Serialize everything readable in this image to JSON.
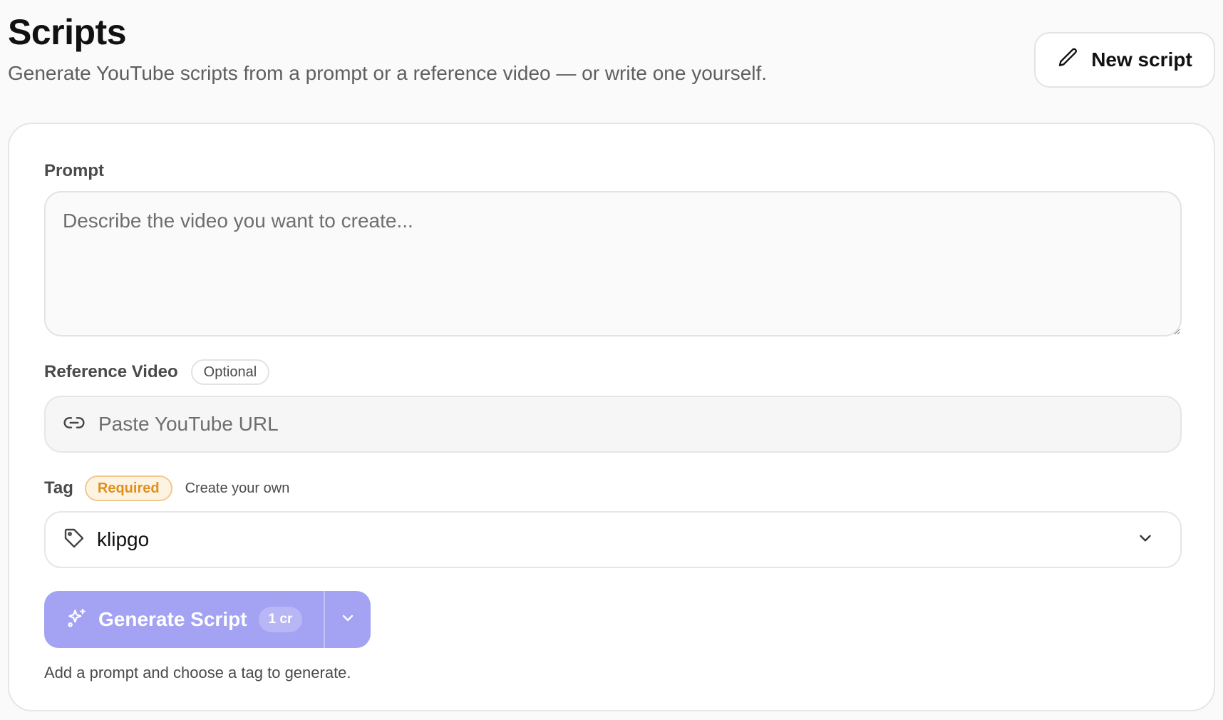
{
  "header": {
    "title": "Scripts",
    "subtitle": "Generate YouTube scripts from a prompt or a reference video — or write one yourself.",
    "new_script_label": "New script"
  },
  "prompt": {
    "label": "Prompt",
    "placeholder": "Describe the video you want to create...",
    "value": ""
  },
  "reference_video": {
    "label": "Reference Video",
    "badge": "Optional",
    "placeholder": "Paste YouTube URL",
    "value": ""
  },
  "tag": {
    "label": "Tag",
    "badge": "Required",
    "create_link": "Create your own",
    "selected": "klipgo"
  },
  "generate": {
    "label": "Generate Script",
    "cost": "1 cr",
    "hint": "Add a prompt and choose a tag to generate."
  },
  "colors": {
    "accent": "#a4a2f3",
    "required_text": "#e0901a",
    "required_bg": "#fdf3e3"
  },
  "icons": {
    "new_script": "pencil-icon",
    "url": "link-icon",
    "tag": "tag-icon",
    "dropdown": "chevron-down-icon",
    "generate": "sparkles-icon"
  }
}
